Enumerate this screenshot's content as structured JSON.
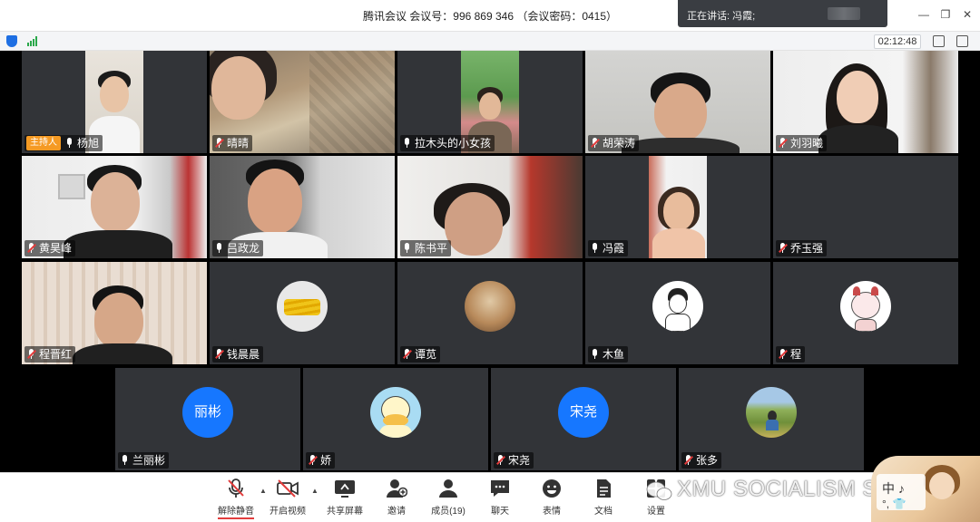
{
  "titlebar": {
    "title": "腾讯会议  会议号：996 869 346  （会议密码：0415）",
    "speaking": "正在讲话: 冯霞;"
  },
  "subbar": {
    "timer": "02:12:48"
  },
  "participants": [
    {
      "name": "杨旭",
      "host": true,
      "host_label": "主持人"
    },
    {
      "name": "晴晴"
    },
    {
      "name": "拉木头的小女孩"
    },
    {
      "name": "胡荣涛"
    },
    {
      "name": "刘羽曦"
    },
    {
      "name": "黄昊峰"
    },
    {
      "name": "吕政龙"
    },
    {
      "name": "陈书平"
    },
    {
      "name": "冯霞"
    },
    {
      "name": "乔玉强"
    },
    {
      "name": "程晋红"
    },
    {
      "name": "钱晨晨"
    },
    {
      "name": "谭苋"
    },
    {
      "name": "木鱼"
    },
    {
      "name": "程"
    },
    {
      "name": "兰丽彬",
      "avatar_text": "丽彬"
    },
    {
      "name": "娇"
    },
    {
      "name": "宋尧",
      "avatar_text": "宋尧"
    },
    {
      "name": "张多"
    }
  ],
  "toolbar": {
    "unmute": "解除静音",
    "video": "开启视频",
    "share": "共享屏幕",
    "invite": "邀请",
    "members": "成员(19)",
    "chat": "聊天",
    "reactions": "表情",
    "docs": "文档",
    "settings": "设置"
  },
  "watermark": "XMU SOCIALISM STUDY",
  "colors": {
    "host_badge": "#f59a23",
    "avatar_blue": "#1677ff",
    "muted_red": "#e23c3c"
  }
}
